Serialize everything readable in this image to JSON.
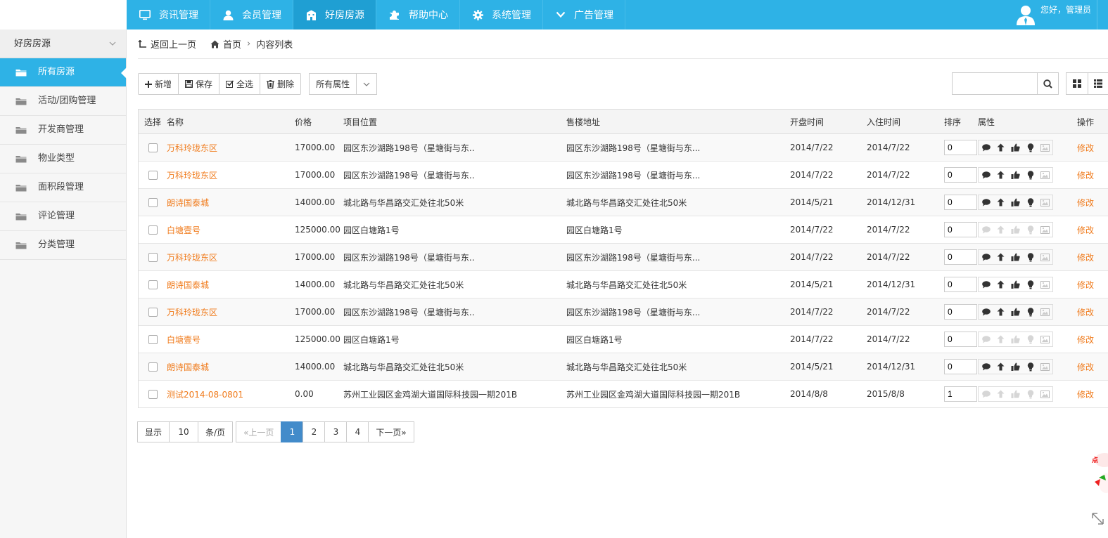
{
  "topnav": [
    {
      "label": "资讯管理",
      "icon": "monitor-icon",
      "active": false
    },
    {
      "label": "会员管理",
      "icon": "user-icon",
      "active": false
    },
    {
      "label": "好房房源",
      "icon": "building-icon",
      "active": true
    },
    {
      "label": "帮助中心",
      "icon": "puzzle-icon",
      "active": false
    },
    {
      "label": "系统管理",
      "icon": "gear-icon",
      "active": false
    },
    {
      "label": "广告管理",
      "icon": "chevron-down-icon",
      "active": false
    }
  ],
  "user": {
    "greeting": "您好，管理员"
  },
  "sidebar": {
    "title": "好房房源",
    "items": [
      {
        "label": "所有房源",
        "active": true
      },
      {
        "label": "活动/团购管理",
        "active": false
      },
      {
        "label": "开发商管理",
        "active": false
      },
      {
        "label": "物业类型",
        "active": false
      },
      {
        "label": "面积段管理",
        "active": false
      },
      {
        "label": "评论管理",
        "active": false
      },
      {
        "label": "分类管理",
        "active": false
      }
    ]
  },
  "breadcrumb": {
    "back": "返回上一页",
    "home": "首页",
    "current": "内容列表"
  },
  "toolbar": {
    "add": "新增",
    "save": "保存",
    "select_all": "全选",
    "delete": "删除",
    "attr_filter": "所有属性"
  },
  "search": {
    "placeholder": ""
  },
  "table": {
    "headers": {
      "select": "选择",
      "name": "名称",
      "price": "价格",
      "location": "项目位置",
      "sales_address": "售楼地址",
      "open_date": "开盘时间",
      "move_in_date": "入住时间",
      "sort": "排序",
      "attributes": "属性",
      "action": "操作"
    },
    "edit_label": "修改",
    "rows": [
      {
        "name": "万科玲珑东区",
        "price": "17000.00",
        "location": "园区东沙湖路198号（星塘街与东..",
        "sales_address": "园区东沙湖路198号（星塘街与东...",
        "open_date": "2014/7/22",
        "move_in_date": "2014/7/22",
        "sort": "0",
        "attrs_active": true
      },
      {
        "name": "万科玲珑东区",
        "price": "17000.00",
        "location": "园区东沙湖路198号（星塘街与东..",
        "sales_address": "园区东沙湖路198号（星塘街与东...",
        "open_date": "2014/7/22",
        "move_in_date": "2014/7/22",
        "sort": "0",
        "attrs_active": true
      },
      {
        "name": "朗诗国泰城",
        "price": "14000.00",
        "location": "城北路与华昌路交汇处往北50米",
        "sales_address": "城北路与华昌路交汇处往北50米",
        "open_date": "2014/5/21",
        "move_in_date": "2014/12/31",
        "sort": "0",
        "attrs_active": true
      },
      {
        "name": "白塘壹号",
        "price": "125000.00",
        "location": "园区白塘路1号",
        "sales_address": "园区白塘路1号",
        "open_date": "2014/7/22",
        "move_in_date": "2014/7/22",
        "sort": "0",
        "attrs_active": false
      },
      {
        "name": "万科玲珑东区",
        "price": "17000.00",
        "location": "园区东沙湖路198号（星塘街与东..",
        "sales_address": "园区东沙湖路198号（星塘街与东...",
        "open_date": "2014/7/22",
        "move_in_date": "2014/7/22",
        "sort": "0",
        "attrs_active": true
      },
      {
        "name": "朗诗国泰城",
        "price": "14000.00",
        "location": "城北路与华昌路交汇处往北50米",
        "sales_address": "城北路与华昌路交汇处往北50米",
        "open_date": "2014/5/21",
        "move_in_date": "2014/12/31",
        "sort": "0",
        "attrs_active": true
      },
      {
        "name": "万科玲珑东区",
        "price": "17000.00",
        "location": "园区东沙湖路198号（星塘街与东..",
        "sales_address": "园区东沙湖路198号（星塘街与东...",
        "open_date": "2014/7/22",
        "move_in_date": "2014/7/22",
        "sort": "0",
        "attrs_active": true
      },
      {
        "name": "白塘壹号",
        "price": "125000.00",
        "location": "园区白塘路1号",
        "sales_address": "园区白塘路1号",
        "open_date": "2014/7/22",
        "move_in_date": "2014/7/22",
        "sort": "0",
        "attrs_active": false
      },
      {
        "name": "朗诗国泰城",
        "price": "14000.00",
        "location": "城北路与华昌路交汇处往北50米",
        "sales_address": "城北路与华昌路交汇处往北50米",
        "open_date": "2014/5/21",
        "move_in_date": "2014/12/31",
        "sort": "0",
        "attrs_active": true
      },
      {
        "name": "测试2014-08-0801",
        "price": "0.00",
        "location": "苏州工业园区金鸡湖大道国际科技园一期201B",
        "sales_address": "苏州工业园区金鸡湖大道国际科技园一期201B",
        "open_date": "2014/8/8",
        "move_in_date": "2015/8/8",
        "sort": "1",
        "attrs_active": false
      }
    ]
  },
  "pager": {
    "show": "显示",
    "page_size": "10",
    "per_page": "条/页",
    "prev": "«上一页",
    "pages": [
      "1",
      "2",
      "3",
      "4"
    ],
    "current": "1",
    "next": "下一页»"
  },
  "colors": {
    "primary": "#2eb2e6",
    "link": "#f07b1c",
    "pager_active": "#428bca"
  }
}
